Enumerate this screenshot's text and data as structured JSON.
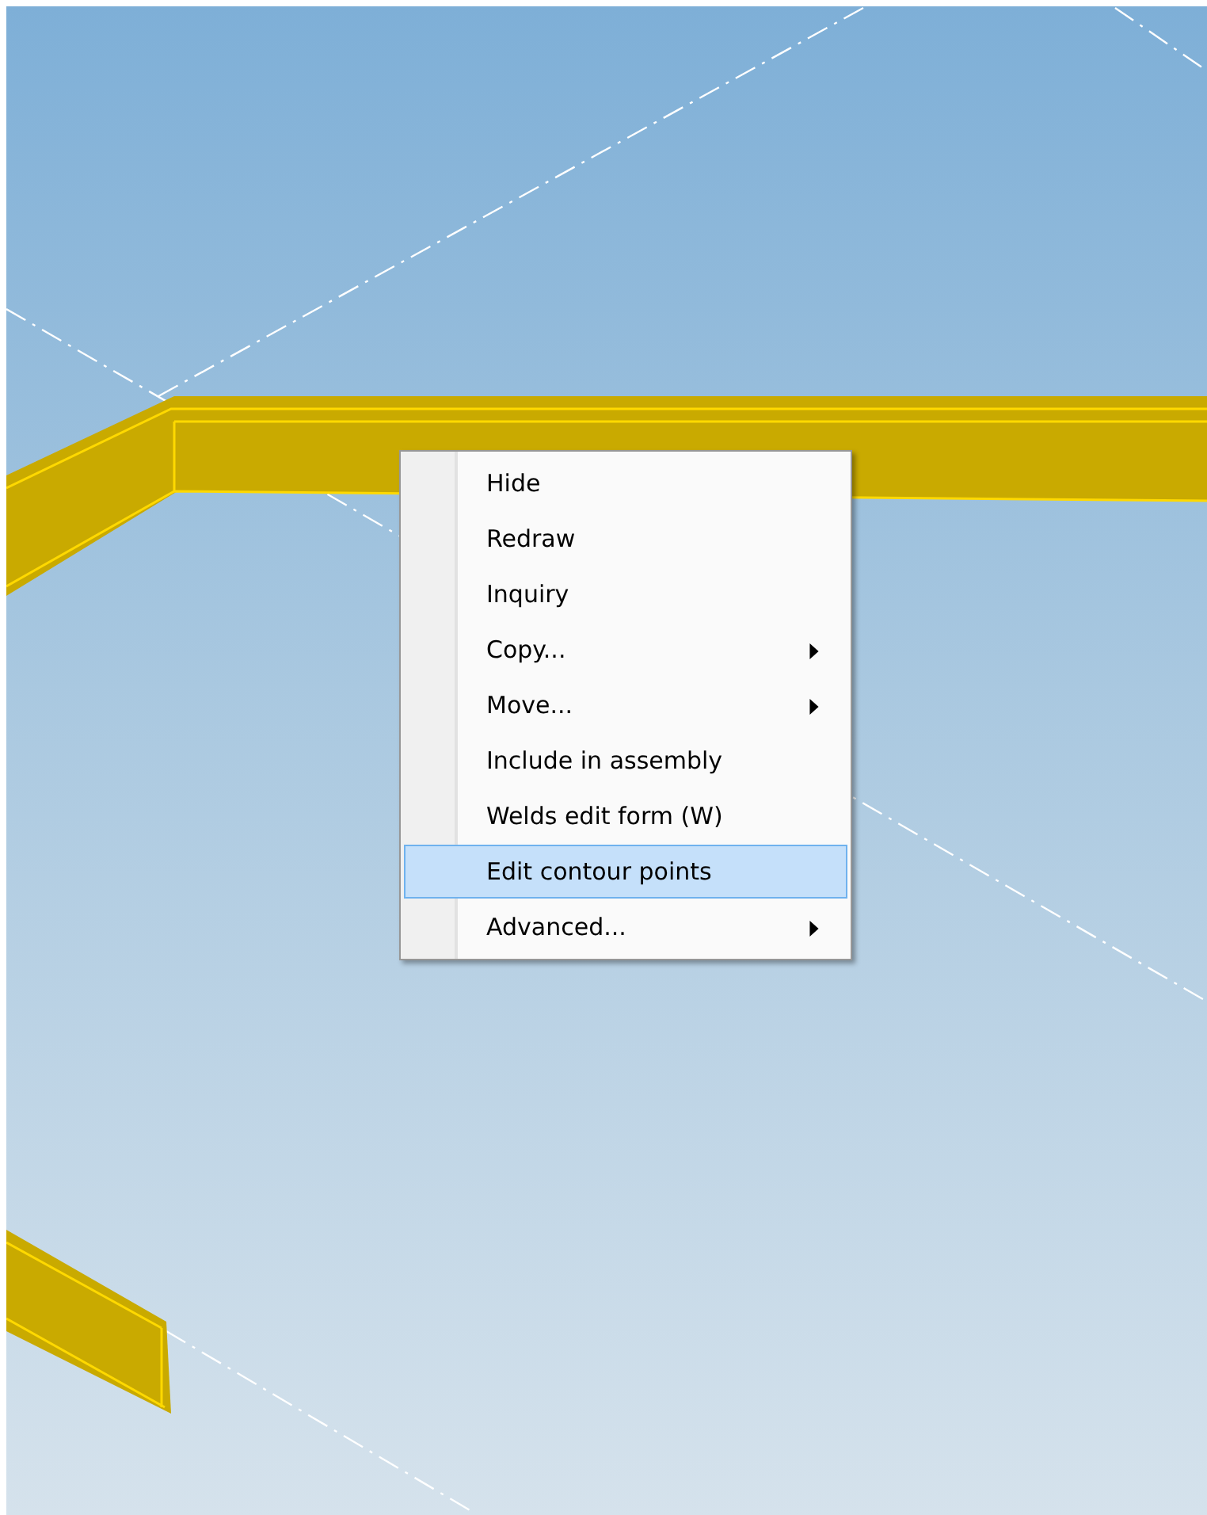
{
  "context_menu": {
    "items": [
      {
        "label": "Hide",
        "submenu": false,
        "selected": false
      },
      {
        "label": "Redraw",
        "submenu": false,
        "selected": false
      },
      {
        "label": "Inquiry",
        "submenu": false,
        "selected": false
      },
      {
        "label": "Copy...",
        "submenu": true,
        "selected": false
      },
      {
        "label": "Move...",
        "submenu": true,
        "selected": false
      },
      {
        "label": "Include in assembly",
        "submenu": false,
        "selected": false
      },
      {
        "label": "Welds edit form (W)",
        "submenu": false,
        "selected": false
      },
      {
        "label": "Edit contour points",
        "submenu": false,
        "selected": true
      },
      {
        "label": "Advanced...",
        "submenu": true,
        "selected": false
      }
    ]
  }
}
